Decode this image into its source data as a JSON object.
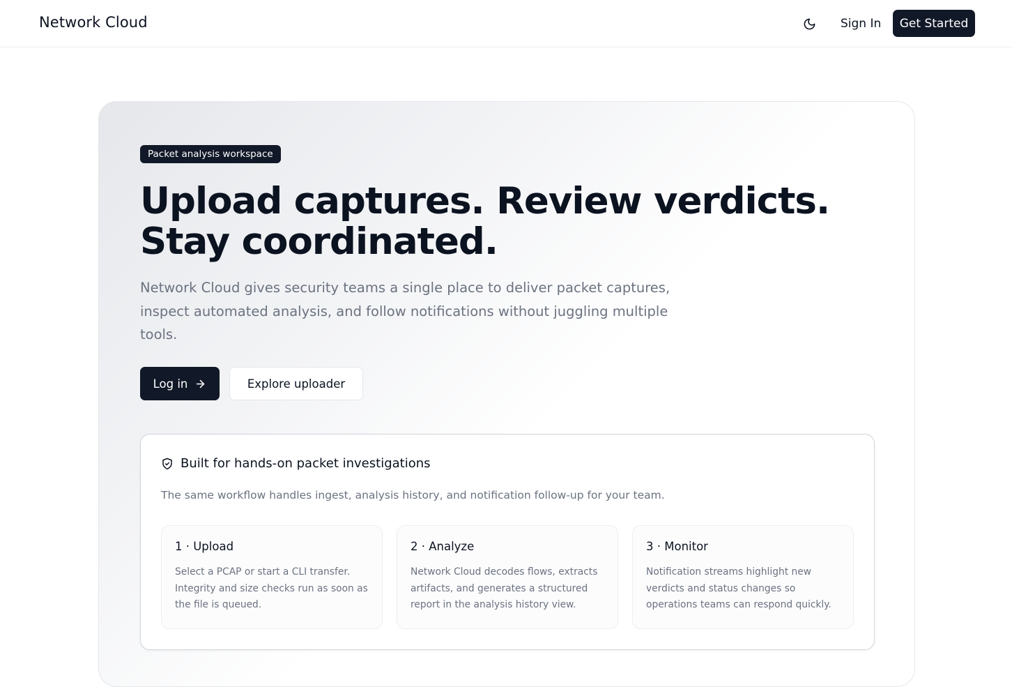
{
  "header": {
    "brand": "Network Cloud",
    "theme_icon": "moon-icon",
    "sign_in": "Sign In",
    "get_started": "Get Started"
  },
  "hero": {
    "badge": "Packet analysis workspace",
    "headline": "Upload captures. Review verdicts. Stay coordinated.",
    "lead": "Network Cloud gives security teams a single place to deliver packet captures, inspect automated analysis, and follow notifications without juggling multiple tools.",
    "login_button": "Log in",
    "login_icon": "arrow-right-icon",
    "explore_button": "Explore uploader"
  },
  "panel": {
    "icon": "shield-check-icon",
    "title": "Built for hands-on packet investigations",
    "subtitle": "The same workflow handles ingest, analysis history, and notification follow-up for your team.",
    "steps": [
      {
        "title": "1 · Upload",
        "body": "Select a PCAP or start a CLI transfer. Integrity and size checks run as soon as the file is queued."
      },
      {
        "title": "2 · Analyze",
        "body": "Network Cloud decodes flows, extracts artifacts, and generates a structured report in the analysis history view."
      },
      {
        "title": "3 · Monitor",
        "body": "Notification streams highlight new verdicts and status changes so operations teams can respond quickly."
      }
    ]
  },
  "colors": {
    "primary": "#111827",
    "muted_text": "#6b7280",
    "border": "#e5e7eb"
  }
}
